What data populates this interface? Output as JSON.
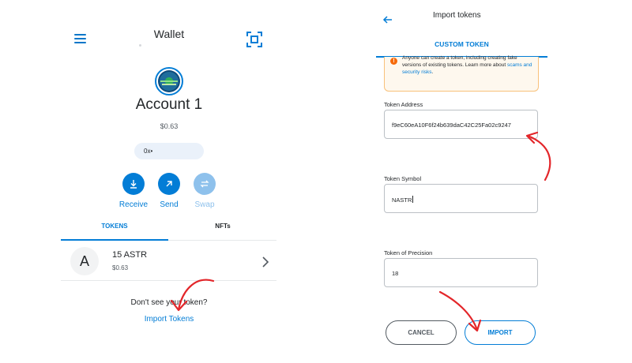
{
  "wallet": {
    "title": "Wallet",
    "account_name": "Account 1",
    "balance": "$0.63",
    "address": "0x•",
    "actions": [
      {
        "label": "Receive",
        "icon": "download-icon",
        "enabled": true
      },
      {
        "label": "Send",
        "icon": "arrow-up-right-icon",
        "enabled": true
      },
      {
        "label": "Swap",
        "icon": "swap-icon",
        "enabled": false
      }
    ],
    "tabs": [
      {
        "label": "TOKENS",
        "active": true
      },
      {
        "label": "NFTs",
        "active": false
      }
    ],
    "tokens": [
      {
        "avatar_letter": "A",
        "amount": "15 ASTR",
        "fiat": "$0.63"
      }
    ],
    "dont_see_text": "Don't see your token?",
    "import_link": "Import Tokens"
  },
  "import_tokens": {
    "title": "Import tokens",
    "tab": "CUSTOM TOKEN",
    "warning": {
      "text": "Anyone can create a token, including creating fake versions of existing tokens. Learn more about",
      "link": "scams and security risks",
      "end": "."
    },
    "fields": [
      {
        "label": "Token Address",
        "value": "f9eC60eA10F6f24b639daC42C25Fa02c9247"
      },
      {
        "label": "Token Symbol",
        "value": "NASTR"
      },
      {
        "label": "Token of Precision",
        "value": "18"
      }
    ],
    "cancel_label": "CANCEL",
    "import_label": "IMPORT"
  },
  "colors": {
    "accent": "#037dd6",
    "annotation": "#e3262a",
    "warning_border": "#f8c17a",
    "warning_bg": "#fef8ee"
  }
}
